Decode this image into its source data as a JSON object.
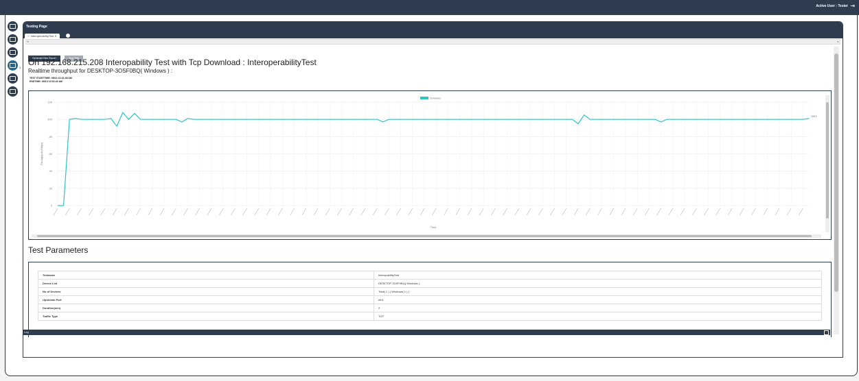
{
  "topbar": {
    "user": "Active User : Tester",
    "logout_icon": "logout-icon"
  },
  "sidebar": {
    "icons": [
      "monitor-icon",
      "cast-icon",
      "devices-icon",
      "test-icon",
      "settings-icon",
      "report-icon"
    ]
  },
  "panel": {
    "title": "Testing Page"
  },
  "tab": {
    "label": "✓ InteroperabilityTest",
    "close": "✕"
  },
  "buttons": {
    "generate": "Generate/View Report",
    "stop": "Stop Test"
  },
  "header": {
    "title": "On 192.168.215.208 Interopability Test with Tcp Download : InteroperabilityTest",
    "subtitle": "Realtime throughput for DESKTOP-3OSF0BQ( Windows ) :",
    "start": "TEST STARTTIME: 08/13 10:31:38 AM",
    "end": "ENDTIME: 08/13 10:33:43 AM"
  },
  "chart_data": {
    "type": "line",
    "legend": "Download",
    "xlabel": "Time",
    "ylabel": "Throughput (Mbps)",
    "ylim": [
      0,
      120
    ],
    "yticks": [
      0,
      20,
      40,
      60,
      80,
      100,
      120
    ],
    "end_label": "100.1",
    "series": [
      {
        "name": "Download",
        "color": "#2ec4c4",
        "values": [
          0,
          0,
          100,
          101,
          100,
          100,
          100,
          100,
          100,
          101,
          92,
          108,
          100,
          107,
          100,
          100,
          100,
          100,
          100,
          100,
          100,
          97,
          101,
          100,
          100,
          100,
          100,
          100,
          100,
          100,
          100,
          100,
          100,
          100,
          100,
          100,
          100,
          100,
          100,
          100,
          100,
          100,
          100,
          100,
          100,
          100,
          100,
          100,
          100,
          100,
          100,
          100,
          100,
          100,
          100,
          97,
          100,
          100,
          100,
          100,
          100,
          100,
          100,
          100,
          100,
          100,
          100,
          100,
          100,
          100,
          100,
          100,
          100,
          100,
          100,
          100,
          100,
          100,
          100,
          100,
          100,
          100,
          100,
          100,
          100,
          100,
          100,
          100,
          95,
          105,
          100,
          100,
          100,
          100,
          100,
          100,
          100,
          100,
          100,
          100,
          100,
          100,
          97,
          100,
          100,
          100,
          100,
          100,
          100,
          100,
          100,
          100,
          100,
          100,
          100,
          100,
          100,
          100,
          100,
          100,
          100,
          100,
          100,
          100,
          100,
          100,
          100,
          101
        ]
      }
    ]
  },
  "params": {
    "heading": "Test Parameters",
    "rows": [
      [
        "Testname",
        "InteropabilityTest"
      ],
      [
        "Device List",
        "DESKTOP-3OSF0BQ( Windows )"
      ],
      [
        "No of Devices",
        "Total( 1 ) ( Windows( 1 ) )"
      ],
      [
        "Upstream Port",
        "eth1"
      ],
      [
        "Duration(min)",
        "2"
      ],
      [
        "Traffic Type",
        "TCP"
      ]
    ]
  },
  "footer": {
    "label": "Log"
  }
}
